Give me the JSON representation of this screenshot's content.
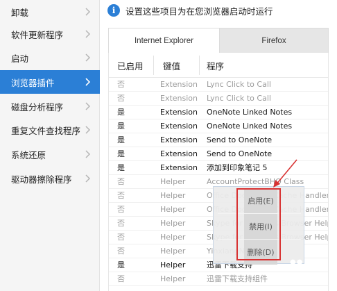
{
  "sidebar": {
    "items": [
      {
        "label": "卸载"
      },
      {
        "label": "软件更新程序"
      },
      {
        "label": "启动"
      },
      {
        "label": "浏览器插件",
        "active": true
      },
      {
        "label": "磁盘分析程序"
      },
      {
        "label": "重复文件查找程序"
      },
      {
        "label": "系统还原"
      },
      {
        "label": "驱动器擦除程序"
      }
    ]
  },
  "infobar": {
    "icon": "info-icon",
    "text": "设置这些项目为在您浏览器启动时运行"
  },
  "tabs": [
    {
      "label": "Internet Explorer",
      "selected": true
    },
    {
      "label": "Firefox",
      "selected": false
    }
  ],
  "table": {
    "headers": [
      "已启用",
      "键值",
      "程序"
    ],
    "rows": [
      {
        "enabled": "否",
        "key": "Extension",
        "program": "Lync Click to Call"
      },
      {
        "enabled": "否",
        "key": "Extension",
        "program": "Lync Click to Call"
      },
      {
        "enabled": "是",
        "key": "Extension",
        "program": "OneNote Linked Notes"
      },
      {
        "enabled": "是",
        "key": "Extension",
        "program": "OneNote Linked Notes"
      },
      {
        "enabled": "是",
        "key": "Extension",
        "program": "Send to OneNote"
      },
      {
        "enabled": "是",
        "key": "Extension",
        "program": "Send to OneNote"
      },
      {
        "enabled": "是",
        "key": "Extension",
        "program": "添加到印象笔记 5"
      },
      {
        "enabled": "否",
        "key": "Helper",
        "program": "AccountProtectBHO Class"
      },
      {
        "enabled": "否",
        "key": "Helper",
        "program": "Office Document Cache Handler"
      },
      {
        "enabled": "否",
        "key": "Helper",
        "program": "Office Document Cache Handler"
      },
      {
        "enabled": "否",
        "key": "Helper",
        "program": "Skype for Business Browser Helper"
      },
      {
        "enabled": "否",
        "key": "Helper",
        "program": "Skype for Business Browser Helper"
      },
      {
        "enabled": "否",
        "key": "Helper",
        "program": "YinxiangNoteBHO"
      },
      {
        "enabled": "是",
        "key": "Helper",
        "program": "迅雷下载支持"
      },
      {
        "enabled": "否",
        "key": "Helper",
        "program": "迅雷下载支持组件"
      }
    ]
  },
  "context_menu": {
    "items": [
      {
        "label": "启用(E)"
      },
      {
        "label": "禁用(I)"
      },
      {
        "label": "删除(D)"
      }
    ]
  },
  "colors": {
    "accent": "#2b7fd6",
    "highlight": "#d83232"
  }
}
